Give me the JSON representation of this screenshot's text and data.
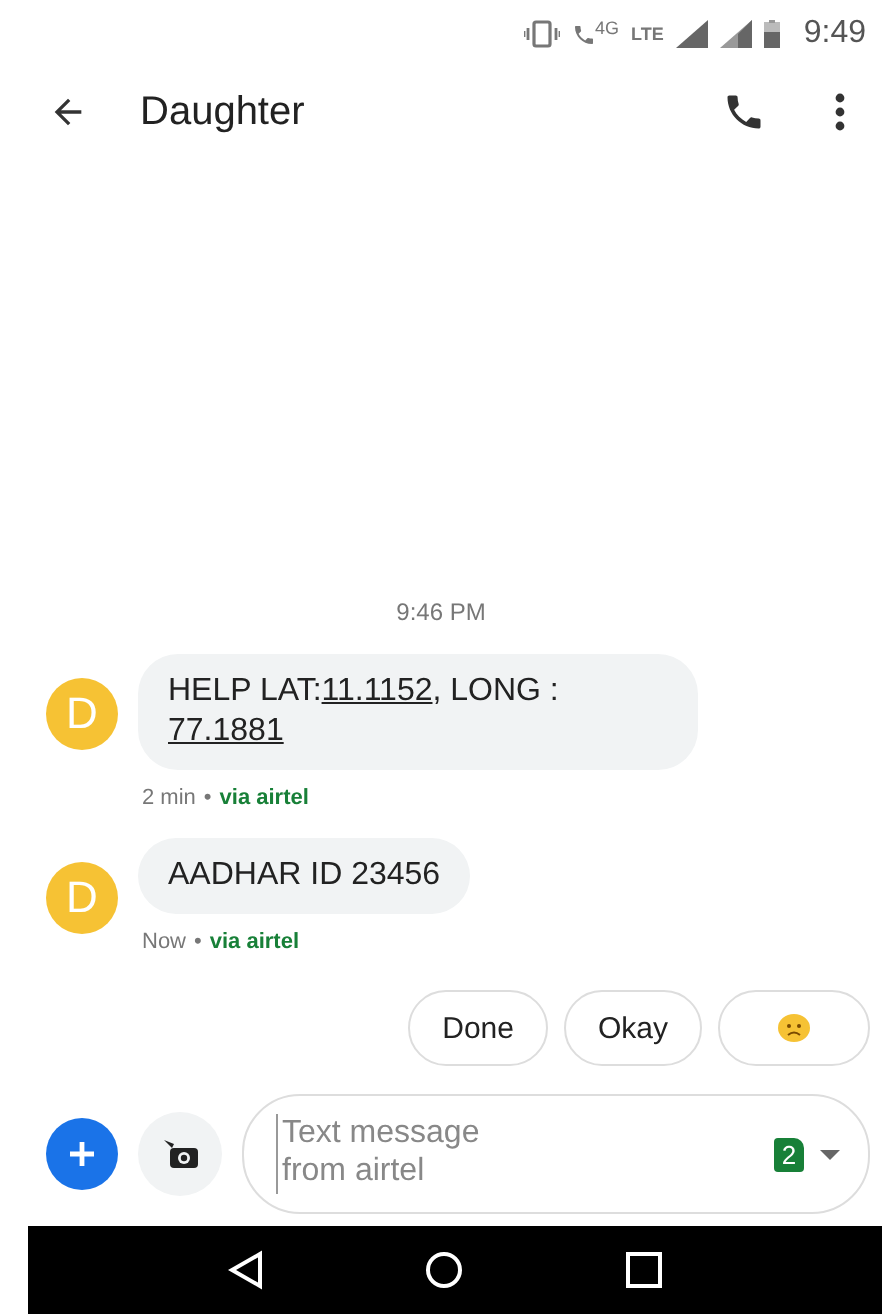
{
  "status_bar": {
    "network_labels": [
      "4G",
      "LTE"
    ],
    "time": "9:49"
  },
  "header": {
    "title": "Daughter"
  },
  "conversation": {
    "timestamp": "9:46 PM",
    "messages": [
      {
        "avatar": "D",
        "parts": [
          {
            "text": "HELP LAT:",
            "link": false
          },
          {
            "text": "11.1152",
            "link": true
          },
          {
            "text": ", LONG : ",
            "link": false
          },
          {
            "text": "77.1881",
            "link": true
          }
        ],
        "age": "2 min",
        "separator": "•",
        "via": "via airtel"
      },
      {
        "avatar": "D",
        "parts": [
          {
            "text": "AADHAR ID 23456",
            "link": false
          }
        ],
        "age": "Now",
        "separator": "•",
        "via": "via airtel"
      }
    ]
  },
  "suggestions": [
    {
      "kind": "text",
      "label": "Done"
    },
    {
      "kind": "text",
      "label": "Okay"
    },
    {
      "kind": "emoji"
    }
  ],
  "compose": {
    "placeholder": "Text message\nfrom airtel",
    "sim": "2"
  }
}
